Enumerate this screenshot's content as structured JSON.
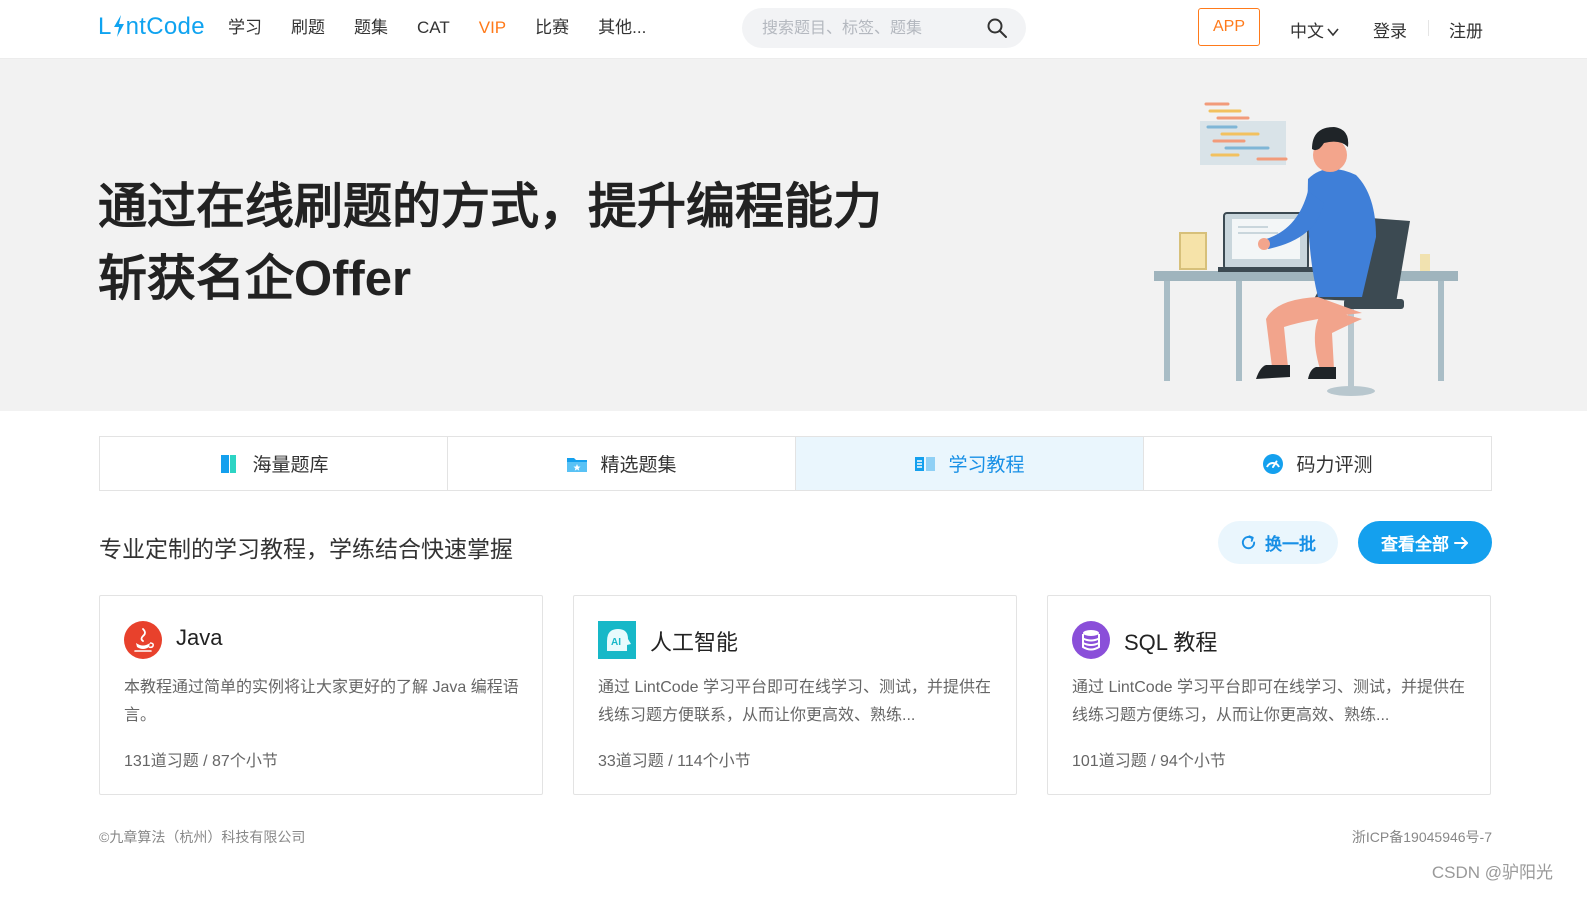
{
  "header": {
    "logo_text_a": "L",
    "logo_text_b": "ntCode",
    "nav": [
      "学习",
      "刷题",
      "题集",
      "CAT",
      "VIP",
      "比赛",
      "其他..."
    ],
    "search_placeholder": "搜索题目、标签、题集",
    "app_label": "APP",
    "language": "中文",
    "login_label": "登录",
    "register_label": "注册"
  },
  "hero": {
    "title_line1": "通过在线刷题的方式，提升编程能力",
    "title_line2": "斩获名企Offer"
  },
  "tabs": [
    {
      "label": "海量题库",
      "icon": "book-icon",
      "active": false
    },
    {
      "label": "精选题集",
      "icon": "folder-icon",
      "active": false
    },
    {
      "label": "学习教程",
      "icon": "tutorial-icon",
      "active": true
    },
    {
      "label": "码力评测",
      "icon": "gauge-icon",
      "active": false
    }
  ],
  "section": {
    "title": "专业定制的学习教程，学练结合快速掌握",
    "refresh_label": "换一批",
    "view_all_label": "查看全部"
  },
  "cards": [
    {
      "title": "Java",
      "icon": "java-icon",
      "description": "本教程通过简单的实例将让大家更好的了解 Java 编程语言。",
      "stats": "131道习题 / 87个小节"
    },
    {
      "title": "人工智能",
      "icon": "ai-icon",
      "description": "通过 LintCode 学习平台即可在线学习、测试，并提供在线练习题方便联系，从而让你更高效、熟练...",
      "stats": "33道习题 / 114个小节"
    },
    {
      "title": "SQL 教程",
      "icon": "database-icon",
      "description": "通过 LintCode 学习平台即可在线学习、测试，并提供在线练习题方便练习，从而让你更高效、熟练...",
      "stats": "101道习题 / 94个小节"
    }
  ],
  "footer": {
    "copyright": "©九章算法（杭州）科技有限公司",
    "icp": "浙ICP备19045946号-7",
    "watermark": "CSDN @驴阳光"
  },
  "colors": {
    "brand": "#0fa3f0",
    "vip": "#ff7a1a",
    "active_tab_bg": "#eaf6fd",
    "primary_button": "#14a0ee"
  }
}
